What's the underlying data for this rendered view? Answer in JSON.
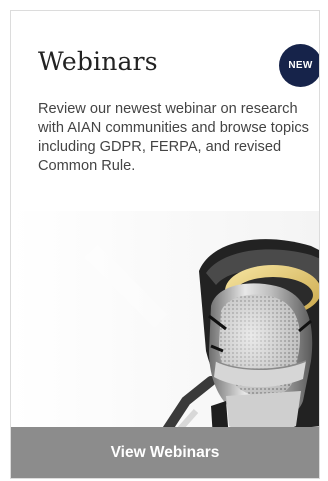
{
  "card": {
    "title": "Webinars",
    "badge": "NEW",
    "description": "Review our newest webinar on research with AIAN communities and browse topics including GDPR, FERPA, and revised Common Rule.",
    "cta_label": "View Webinars",
    "image_subject": "studio-microphone",
    "colors": {
      "badge_bg": "#16234a",
      "cta_bg": "#8c8c8c",
      "title_text": "#222222",
      "body_text": "#444444"
    }
  }
}
